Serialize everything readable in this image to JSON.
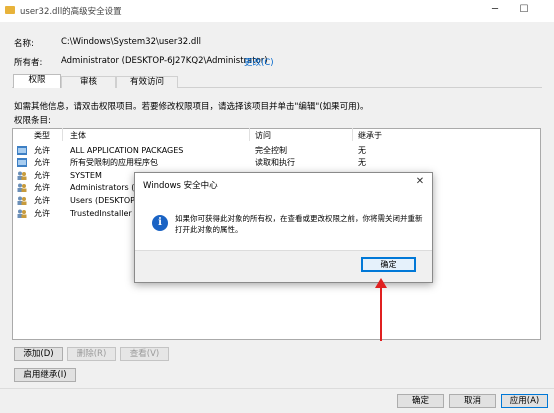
{
  "window": {
    "title": "user32.dll的高级安全设置",
    "minimize": "─",
    "maximize": "☐"
  },
  "info": {
    "name_label": "名称:",
    "name_value": "C:\\Windows\\System32\\user32.dll",
    "owner_label": "所有者:",
    "owner_value": "Administrator (DESKTOP-6J27KQ2\\Administrator)",
    "change_link": "更改(C)"
  },
  "tabs": [
    "权限",
    "审核",
    "有效访问"
  ],
  "instructions": "如需其他信息，请双击权限项目。若要修改权限项目，请选择该项目并单击\"编辑\"(如果可用)。",
  "entries_label": "权限条目:",
  "columns": [
    "类型",
    "主体",
    "访问",
    "继承于"
  ],
  "rows": [
    {
      "type": "允许",
      "principal": "ALL APPLICATION PACKAGES",
      "access": "完全控制",
      "inherit": "无"
    },
    {
      "type": "允许",
      "principal": "所有受限制的应用程序包",
      "access": "读取和执行",
      "inherit": "无"
    },
    {
      "type": "允许",
      "principal": "SYSTEM",
      "access": "",
      "inherit": ""
    },
    {
      "type": "允许",
      "principal": "Administrators (D",
      "access": "",
      "inherit": ""
    },
    {
      "type": "允许",
      "principal": "Users (DESKTOP-6",
      "access": "",
      "inherit": ""
    },
    {
      "type": "允许",
      "principal": "TrustedInstaller",
      "access": "",
      "inherit": ""
    }
  ],
  "buttons": {
    "add": "添加(D)",
    "remove": "删除(R)",
    "view": "查看(V)",
    "enable_inheritance": "启用继承(I)",
    "ok": "确定",
    "cancel": "取消",
    "apply": "应用(A)"
  },
  "dialog": {
    "title": "Windows 安全中心",
    "close": "✕",
    "icon": "i",
    "message": "如果你可获得此对象的所有权，在查看或更改权限之前，你将需关闭并重新打开此对象的属性。",
    "ok": "确定"
  },
  "colors": {
    "accent": "#0078d7",
    "arrow": "#e02020",
    "info_icon": "#1a63c4"
  }
}
